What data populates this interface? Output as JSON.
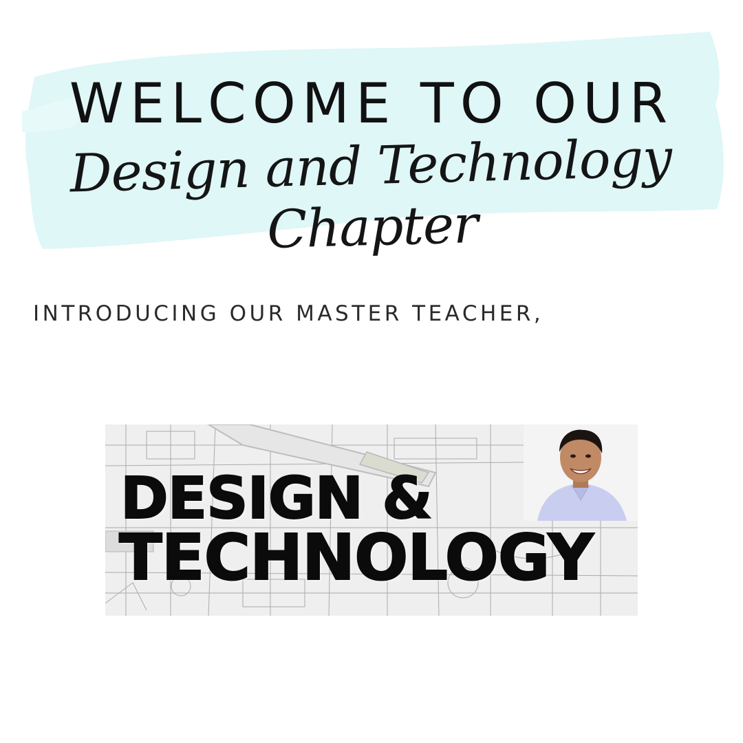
{
  "header": {
    "title": "WELCOME TO OUR",
    "subtitle": "Design and Technology Chapter"
  },
  "intro": {
    "text": "INTRODUCING OUR MASTER TEACHER,"
  },
  "banner": {
    "line1": "DESIGN &",
    "line2": "TECHNOLOGY"
  },
  "colors": {
    "brush": "#dff7f6",
    "text": "#111111",
    "banner_text": "#0b0b0b",
    "shirt": "#c9cdf0"
  }
}
